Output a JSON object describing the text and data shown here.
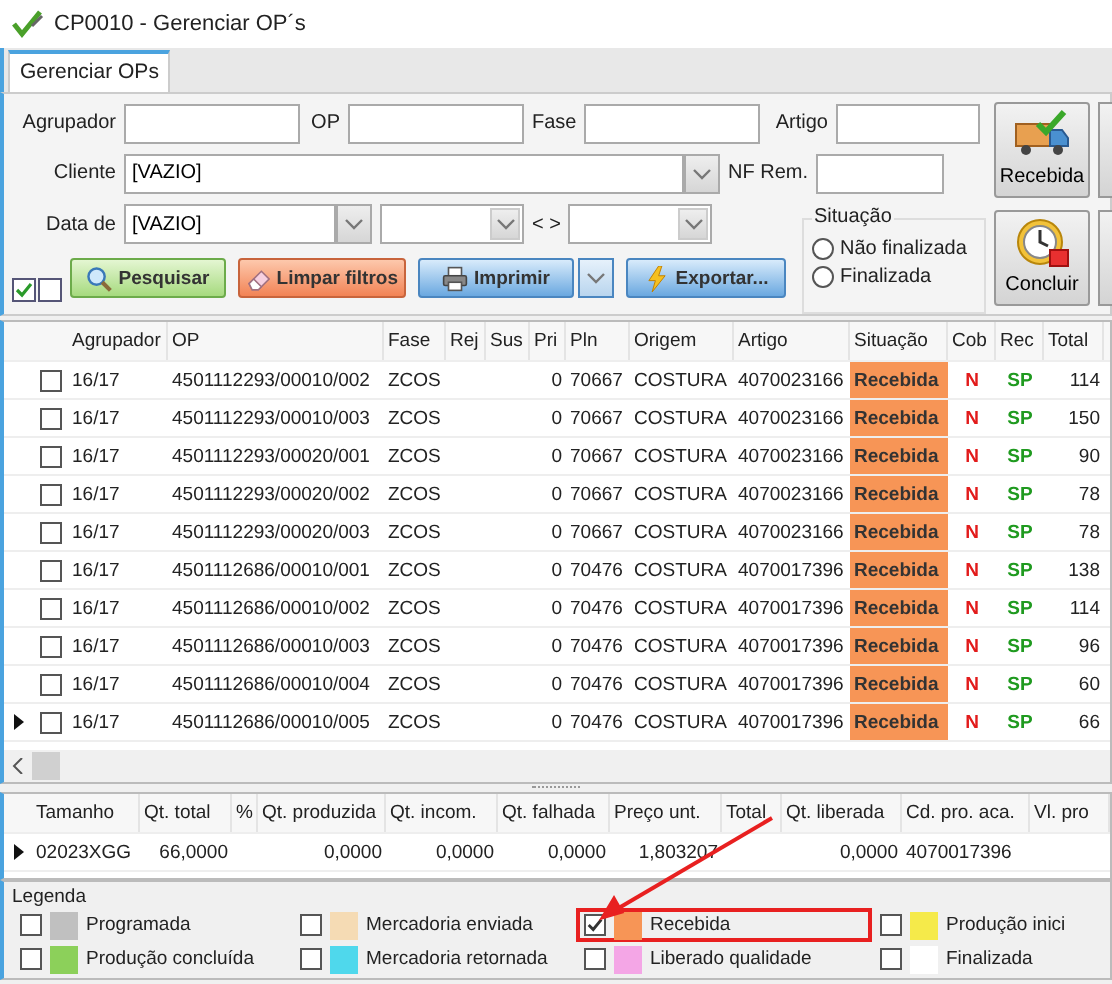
{
  "window": {
    "title": "CP0010 - Gerenciar OP´s"
  },
  "tabs": [
    {
      "label": "Gerenciar OPs",
      "selected": true
    }
  ],
  "filters": {
    "agrupador": {
      "label": "Agrupador"
    },
    "op": {
      "label": "OP"
    },
    "fase": {
      "label": "Fase"
    },
    "artigo": {
      "label": "Artigo"
    },
    "cliente": {
      "label": "Cliente",
      "value": "[VAZIO]"
    },
    "nf_rem": {
      "label": "NF Rem."
    },
    "data_de": {
      "label": "Data de",
      "value": "[VAZIO]"
    },
    "range_sep": "< >"
  },
  "situacao": {
    "title": "Situação",
    "options": [
      {
        "label": "Não finalizada",
        "selected": false
      },
      {
        "label": "Finalizada",
        "selected": false
      }
    ]
  },
  "select_toggles": [
    {
      "checked": true
    },
    {
      "checked": false
    }
  ],
  "action_buttons": [
    {
      "kind": "search",
      "label": "Pesquisar"
    },
    {
      "kind": "clear",
      "label": "Limpar filtros"
    },
    {
      "kind": "print",
      "label": "Imprimir"
    },
    {
      "kind": "export",
      "label": "Exportar..."
    }
  ],
  "side_buttons": [
    {
      "kind": "truck",
      "label": "Recebida"
    },
    {
      "kind": "clock",
      "label": "Concluir"
    }
  ],
  "table": {
    "columns": [
      "Agrupador",
      "OP",
      "Fase",
      "Rej",
      "Sus",
      "Pri",
      "Pln",
      "Origem",
      "Artigo",
      "Situação",
      "Cob",
      "Rec",
      "Total"
    ],
    "rows": [
      {
        "current": false,
        "checked": false,
        "cells": [
          "16/17",
          "4501112293/00010/002",
          "ZCOS",
          "",
          "",
          "0",
          "70667",
          "COSTURA",
          "4070023166",
          "Recebida",
          "N",
          "SP",
          "114"
        ],
        "color": "#f79556"
      },
      {
        "current": false,
        "checked": false,
        "cells": [
          "16/17",
          "4501112293/00010/003",
          "ZCOS",
          "",
          "",
          "0",
          "70667",
          "COSTURA",
          "4070023166",
          "Recebida",
          "N",
          "SP",
          "150"
        ],
        "color": "#f79556"
      },
      {
        "current": false,
        "checked": false,
        "cells": [
          "16/17",
          "4501112293/00020/001",
          "ZCOS",
          "",
          "",
          "0",
          "70667",
          "COSTURA",
          "4070023166",
          "Recebida",
          "N",
          "SP",
          "90"
        ],
        "color": "#f79556"
      },
      {
        "current": false,
        "checked": false,
        "cells": [
          "16/17",
          "4501112293/00020/002",
          "ZCOS",
          "",
          "",
          "0",
          "70667",
          "COSTURA",
          "4070023166",
          "Recebida",
          "N",
          "SP",
          "78"
        ],
        "color": "#f79556"
      },
      {
        "current": false,
        "checked": false,
        "cells": [
          "16/17",
          "4501112293/00020/003",
          "ZCOS",
          "",
          "",
          "0",
          "70667",
          "COSTURA",
          "4070023166",
          "Recebida",
          "N",
          "SP",
          "78"
        ],
        "color": "#f79556"
      },
      {
        "current": false,
        "checked": false,
        "cells": [
          "16/17",
          "4501112686/00010/001",
          "ZCOS",
          "",
          "",
          "0",
          "70476",
          "COSTURA",
          "4070017396",
          "Recebida",
          "N",
          "SP",
          "138"
        ],
        "color": "#f79556"
      },
      {
        "current": false,
        "checked": false,
        "cells": [
          "16/17",
          "4501112686/00010/002",
          "ZCOS",
          "",
          "",
          "0",
          "70476",
          "COSTURA",
          "4070017396",
          "Recebida",
          "N",
          "SP",
          "114"
        ],
        "color": "#f79556"
      },
      {
        "current": false,
        "checked": false,
        "cells": [
          "16/17",
          "4501112686/00010/003",
          "ZCOS",
          "",
          "",
          "0",
          "70476",
          "COSTURA",
          "4070017396",
          "Recebida",
          "N",
          "SP",
          "96"
        ],
        "color": "#f79556"
      },
      {
        "current": false,
        "checked": false,
        "cells": [
          "16/17",
          "4501112686/00010/004",
          "ZCOS",
          "",
          "",
          "0",
          "70476",
          "COSTURA",
          "4070017396",
          "Recebida",
          "N",
          "SP",
          "60"
        ],
        "color": "#f79556"
      },
      {
        "current": true,
        "checked": false,
        "cells": [
          "16/17",
          "4501112686/00010/005",
          "ZCOS",
          "",
          "",
          "0",
          "70476",
          "COSTURA",
          "4070017396",
          "Recebida",
          "N",
          "SP",
          "66"
        ],
        "color": "#f79556"
      }
    ]
  },
  "detail": {
    "columns": [
      "Tamanho",
      "Qt. total",
      "%",
      "Qt. produzida",
      "Qt. incom.",
      "Qt. falhada",
      "Preço unt.",
      "Total",
      "Qt. liberada",
      "Cd. pro. aca.",
      "Vl. pro"
    ],
    "rows": [
      {
        "current": true,
        "cells": [
          "02023XGG",
          "66,0000",
          "",
          "0,0000",
          "0,0000",
          "0,0000",
          "1,803207",
          "",
          "0,0000",
          "4070017396",
          ""
        ]
      }
    ]
  },
  "legend": {
    "title": "Legenda",
    "items": [
      {
        "label": "Programada",
        "color": "#c0c0c0",
        "checked": false,
        "highlighted": false
      },
      {
        "label": "Mercadoria enviada",
        "color": "#f5dbb4",
        "checked": false,
        "highlighted": false
      },
      {
        "label": "Recebida",
        "color": "#f79556",
        "checked": true,
        "highlighted": true
      },
      {
        "label": "Produção inici",
        "color": "#f5ea4a",
        "checked": false,
        "highlighted": false
      },
      {
        "label": "Produção concluída",
        "color": "#8cd05a",
        "checked": false,
        "highlighted": false
      },
      {
        "label": "Mercadoria retornada",
        "color": "#4fd8ec",
        "checked": false,
        "highlighted": false
      },
      {
        "label": "Liberado qualidade",
        "color": "#f4a6e6",
        "checked": false,
        "highlighted": false
      },
      {
        "label": "Finalizada",
        "color": "#ffffff",
        "checked": false,
        "highlighted": false
      }
    ]
  }
}
